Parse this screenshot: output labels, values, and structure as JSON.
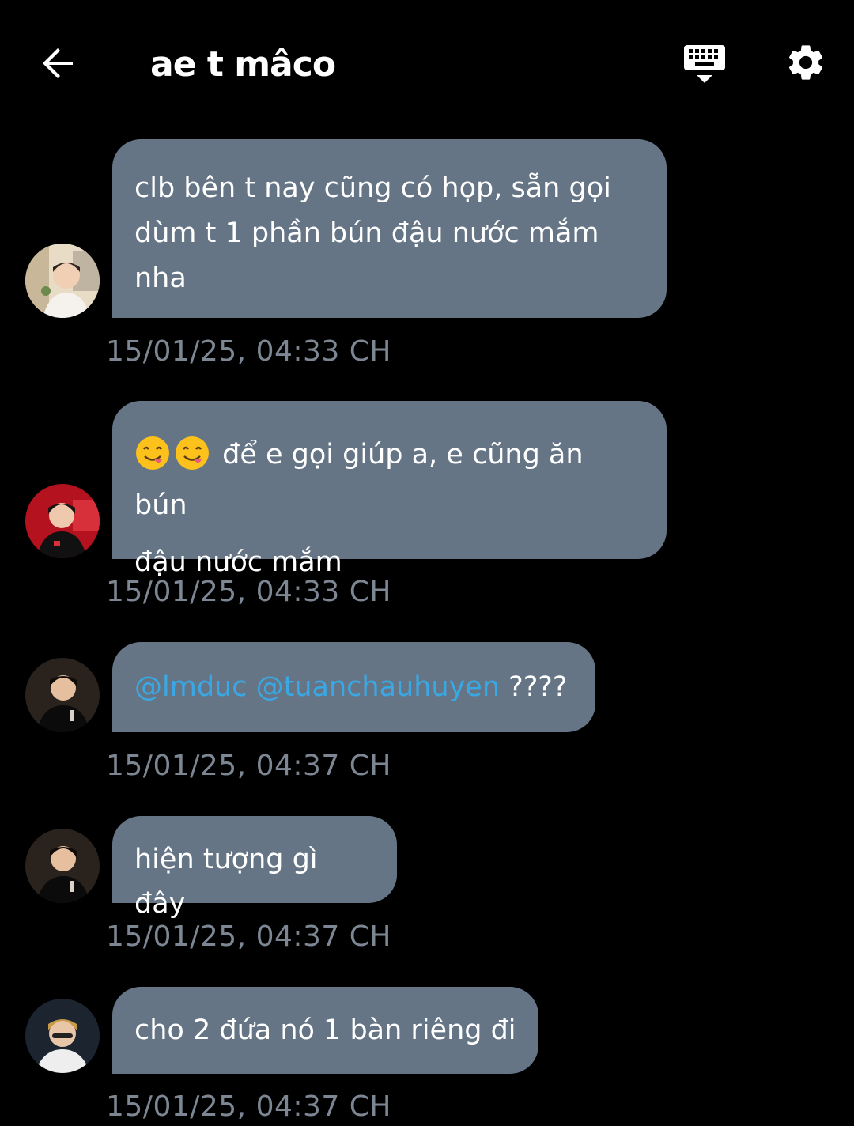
{
  "header": {
    "title": "ae t mâco",
    "back_icon": "arrow-left-icon",
    "keyboard_icon": "keyboard-hide-icon",
    "settings_icon": "gear-icon"
  },
  "colors": {
    "background": "#000000",
    "bubble": "#657585",
    "timestamp": "#7d8793",
    "mention": "#3aa8e4"
  },
  "messages": [
    {
      "avatar": "avatar-user-1",
      "lines": [
        "clb bên t nay cũng có họp, sẵn gọi",
        "dùm t 1 phần bún đậu nước mắm",
        "nha"
      ],
      "timestamp": "15/01/25, 04:33 CH"
    },
    {
      "avatar": "avatar-user-2",
      "emojis": [
        "😋",
        "😋"
      ],
      "line1_after_emoji": " để e gọi giúp a, e cũng ăn bún",
      "line2": "đậu nước mắm",
      "timestamp": "15/01/25, 04:33 CH"
    },
    {
      "avatar": "avatar-user-3",
      "mention1": "@lmduc",
      "mention2": "@tuanchauhuyen",
      "trailing": " ????",
      "timestamp": "15/01/25, 04:37 CH"
    },
    {
      "avatar": "avatar-user-3",
      "text": "hiện tượng gì đây",
      "timestamp": "15/01/25, 04:37 CH"
    },
    {
      "avatar": "avatar-user-4",
      "text": "cho 2 đứa nó 1 bàn riêng đi",
      "timestamp": "15/01/25, 04:37 CH"
    }
  ]
}
